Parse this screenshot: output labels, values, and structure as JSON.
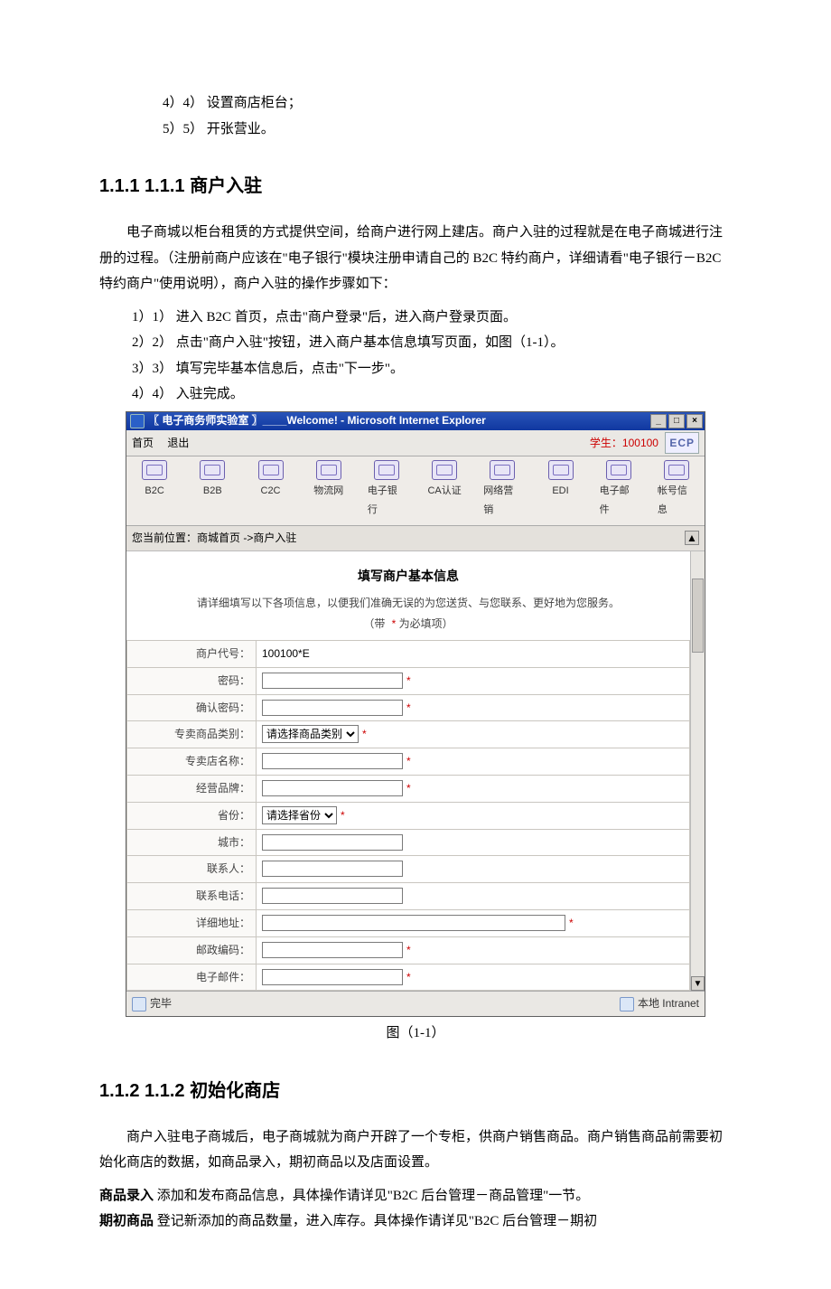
{
  "pre_list": [
    "4）4）  设置商店柜台；",
    "5）5）  开张营业。"
  ],
  "section1": {
    "heading": "1.1.1   1.1.1   商户入驻",
    "intro": "电子商城以柜台租赁的方式提供空间，给商户进行网上建店。商户入驻的过程就是在电子商城进行注册的过程。（注册前商户应该在\"电子银行\"模块注册申请自己的 B2C 特约商户，详细请看\"电子银行－B2C 特约商户\"使用说明），商户入驻的操作步骤如下：",
    "steps": [
      "1）1）  进入 B2C 首页，点击\"商户登录\"后，进入商户登录页面。",
      "2）2）  点击\"商户入驻\"按钮，进入商户基本信息填写页面，如图（1-1）。",
      "3）3）  填写完毕基本信息后，点击\"下一步\"。",
      "4）4）  入驻完成。"
    ],
    "figure_caption": "图（1-1）"
  },
  "screenshot": {
    "window_title": "〖 电子商务师实验室 〗____Welcome! - Microsoft Internet Explorer",
    "win_buttons": {
      "min": "_",
      "max": "□",
      "close": "×"
    },
    "menu": {
      "home": "首页",
      "exit": "退出"
    },
    "student_label": "学生：",
    "student_id": "100100",
    "ecp": "ECP",
    "toolbar": [
      "B2C",
      "B2B",
      "C2C",
      "物流网",
      "电子银行",
      "CA认证",
      "网络营销",
      "EDI",
      "电子邮件",
      "帐号信息"
    ],
    "location_label": "您当前位置：商城首页 ->商户入驻",
    "form_title": "填写商户基本信息",
    "form_note_a": "请详细填写以下各项信息，以便我们准确无误的为您送货、与您联系、更好地为您服务。",
    "form_note_b": "（带 ",
    "form_note_c": " 为必填项）",
    "fields": {
      "code_label": "商户代号：",
      "code_value": "100100*E",
      "pwd_label": "密码：",
      "pwd2_label": "确认密码：",
      "cat_label": "专卖商品类别：",
      "cat_option": "请选择商品类别",
      "name_label": "专卖店名称：",
      "brand_label": "经营品牌：",
      "prov_label": "省份：",
      "prov_option": "请选择省份",
      "city_label": "城市：",
      "contact_label": "联系人：",
      "phone_label": "联系电话：",
      "addr_label": "详细地址：",
      "zip_label": "邮政编码：",
      "email_label": "电子邮件："
    },
    "ast": "*",
    "status_left": "完毕",
    "status_right": "本地 Intranet"
  },
  "section2": {
    "heading": "1.1.2   1.1.2   初始化商店",
    "intro": "商户入驻电子商城后，电子商城就为商户开辟了一个专柜，供商户销售商品。商户销售商品前需要初始化商店的数据，如商品录入，期初商品以及店面设置。",
    "defs": [
      {
        "term": "商品录入",
        "desc": "    添加和发布商品信息，具体操作请详见\"B2C 后台管理－商品管理\"一节。"
      },
      {
        "term": "期初商品",
        "desc": "    登记新添加的商品数量，进入库存。具体操作请详见\"B2C 后台管理－期初"
      }
    ]
  }
}
